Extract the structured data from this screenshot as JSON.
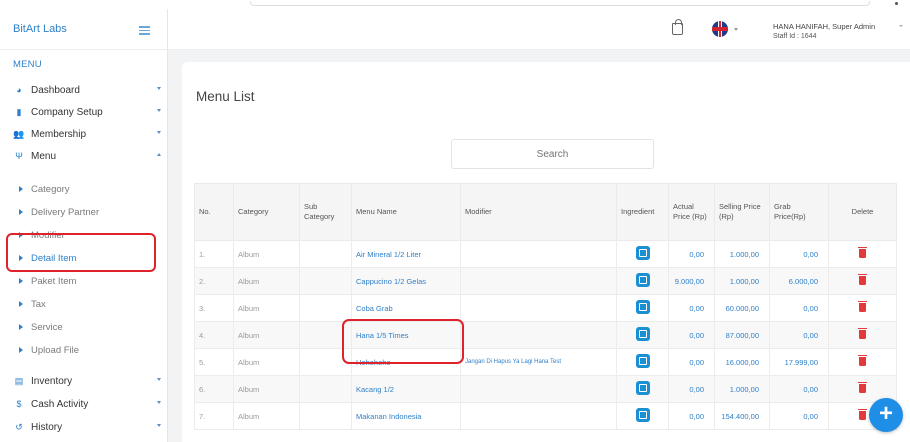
{
  "brand": {
    "name": "BitArt Labs"
  },
  "sidebar": {
    "menu_title": "MENU",
    "items": [
      {
        "label": "Dashboard",
        "icon": "dashboard-icon",
        "expanded": false
      },
      {
        "label": "Company Setup",
        "icon": "building-icon",
        "expanded": false
      },
      {
        "label": "Membership",
        "icon": "users-icon",
        "expanded": false
      },
      {
        "label": "Menu",
        "icon": "fork-knife-icon",
        "expanded": true
      }
    ],
    "sub_items": [
      {
        "label": "Category"
      },
      {
        "label": "Delivery Partner"
      },
      {
        "label": "Modifier"
      },
      {
        "label": "Detail Item",
        "active": true
      },
      {
        "label": "Paket Item"
      },
      {
        "label": "Tax"
      },
      {
        "label": "Service"
      },
      {
        "label": "Upload File"
      }
    ],
    "bottom_items": [
      {
        "label": "Inventory",
        "icon": "inventory-icon"
      },
      {
        "label": "Cash Activity",
        "icon": "dollar-icon"
      },
      {
        "label": "History",
        "icon": "history-icon"
      }
    ]
  },
  "header": {
    "user_name": "HANA HANIFAH, Super Admin",
    "staff_id": "Staff Id : 1644"
  },
  "main": {
    "title": "Menu List",
    "search_placeholder": "Search",
    "columns": [
      "No.",
      "Category",
      "Sub Category",
      "Menu Name",
      "Modifier",
      "Ingredient",
      "Actual Price (Rp)",
      "Selling Price (Rp)",
      "Grab Price(Rp)",
      "Delete"
    ],
    "rows": [
      {
        "no": "1.",
        "category": "Album",
        "sub": "",
        "menu": "Air Mineral 1/2 Liter",
        "modifier": "",
        "actual": "0,00",
        "selling": "1.000,00",
        "grab": "0,00"
      },
      {
        "no": "2.",
        "category": "Album",
        "sub": "",
        "menu": "Cappucino 1/2 Gelas",
        "modifier": "",
        "actual": "9.000,00",
        "selling": "1.000,00",
        "grab": "6.000,00"
      },
      {
        "no": "3.",
        "category": "Album",
        "sub": "",
        "menu": "Coba Grab",
        "modifier": "",
        "actual": "0,00",
        "selling": "60.000,00",
        "grab": "0,00"
      },
      {
        "no": "4.",
        "category": "Album",
        "sub": "",
        "menu": "Hana 1/5 Times",
        "modifier": "",
        "actual": "0,00",
        "selling": "87.000,00",
        "grab": "0,00"
      },
      {
        "no": "5.",
        "category": "Album",
        "sub": "",
        "menu": "Hehehehe",
        "modifier": "Jangan Di Hapus Ya Lagi Hana Test",
        "actual": "0,00",
        "selling": "16.000,00",
        "grab": "17.999,00"
      },
      {
        "no": "6.",
        "category": "Album",
        "sub": "",
        "menu": "Kacang 1/2",
        "modifier": "",
        "actual": "0,00",
        "selling": "1.000,00",
        "grab": "0,00"
      },
      {
        "no": "7.",
        "category": "Album",
        "sub": "",
        "menu": "Makanan Indonesia",
        "modifier": "",
        "actual": "0,00",
        "selling": "154.400,00",
        "grab": "0,00"
      }
    ]
  },
  "colors": {
    "accent": "#2f80c8",
    "highlight": "#e0222a",
    "fab": "#1f8ee6",
    "delete": "#e03a3a"
  }
}
